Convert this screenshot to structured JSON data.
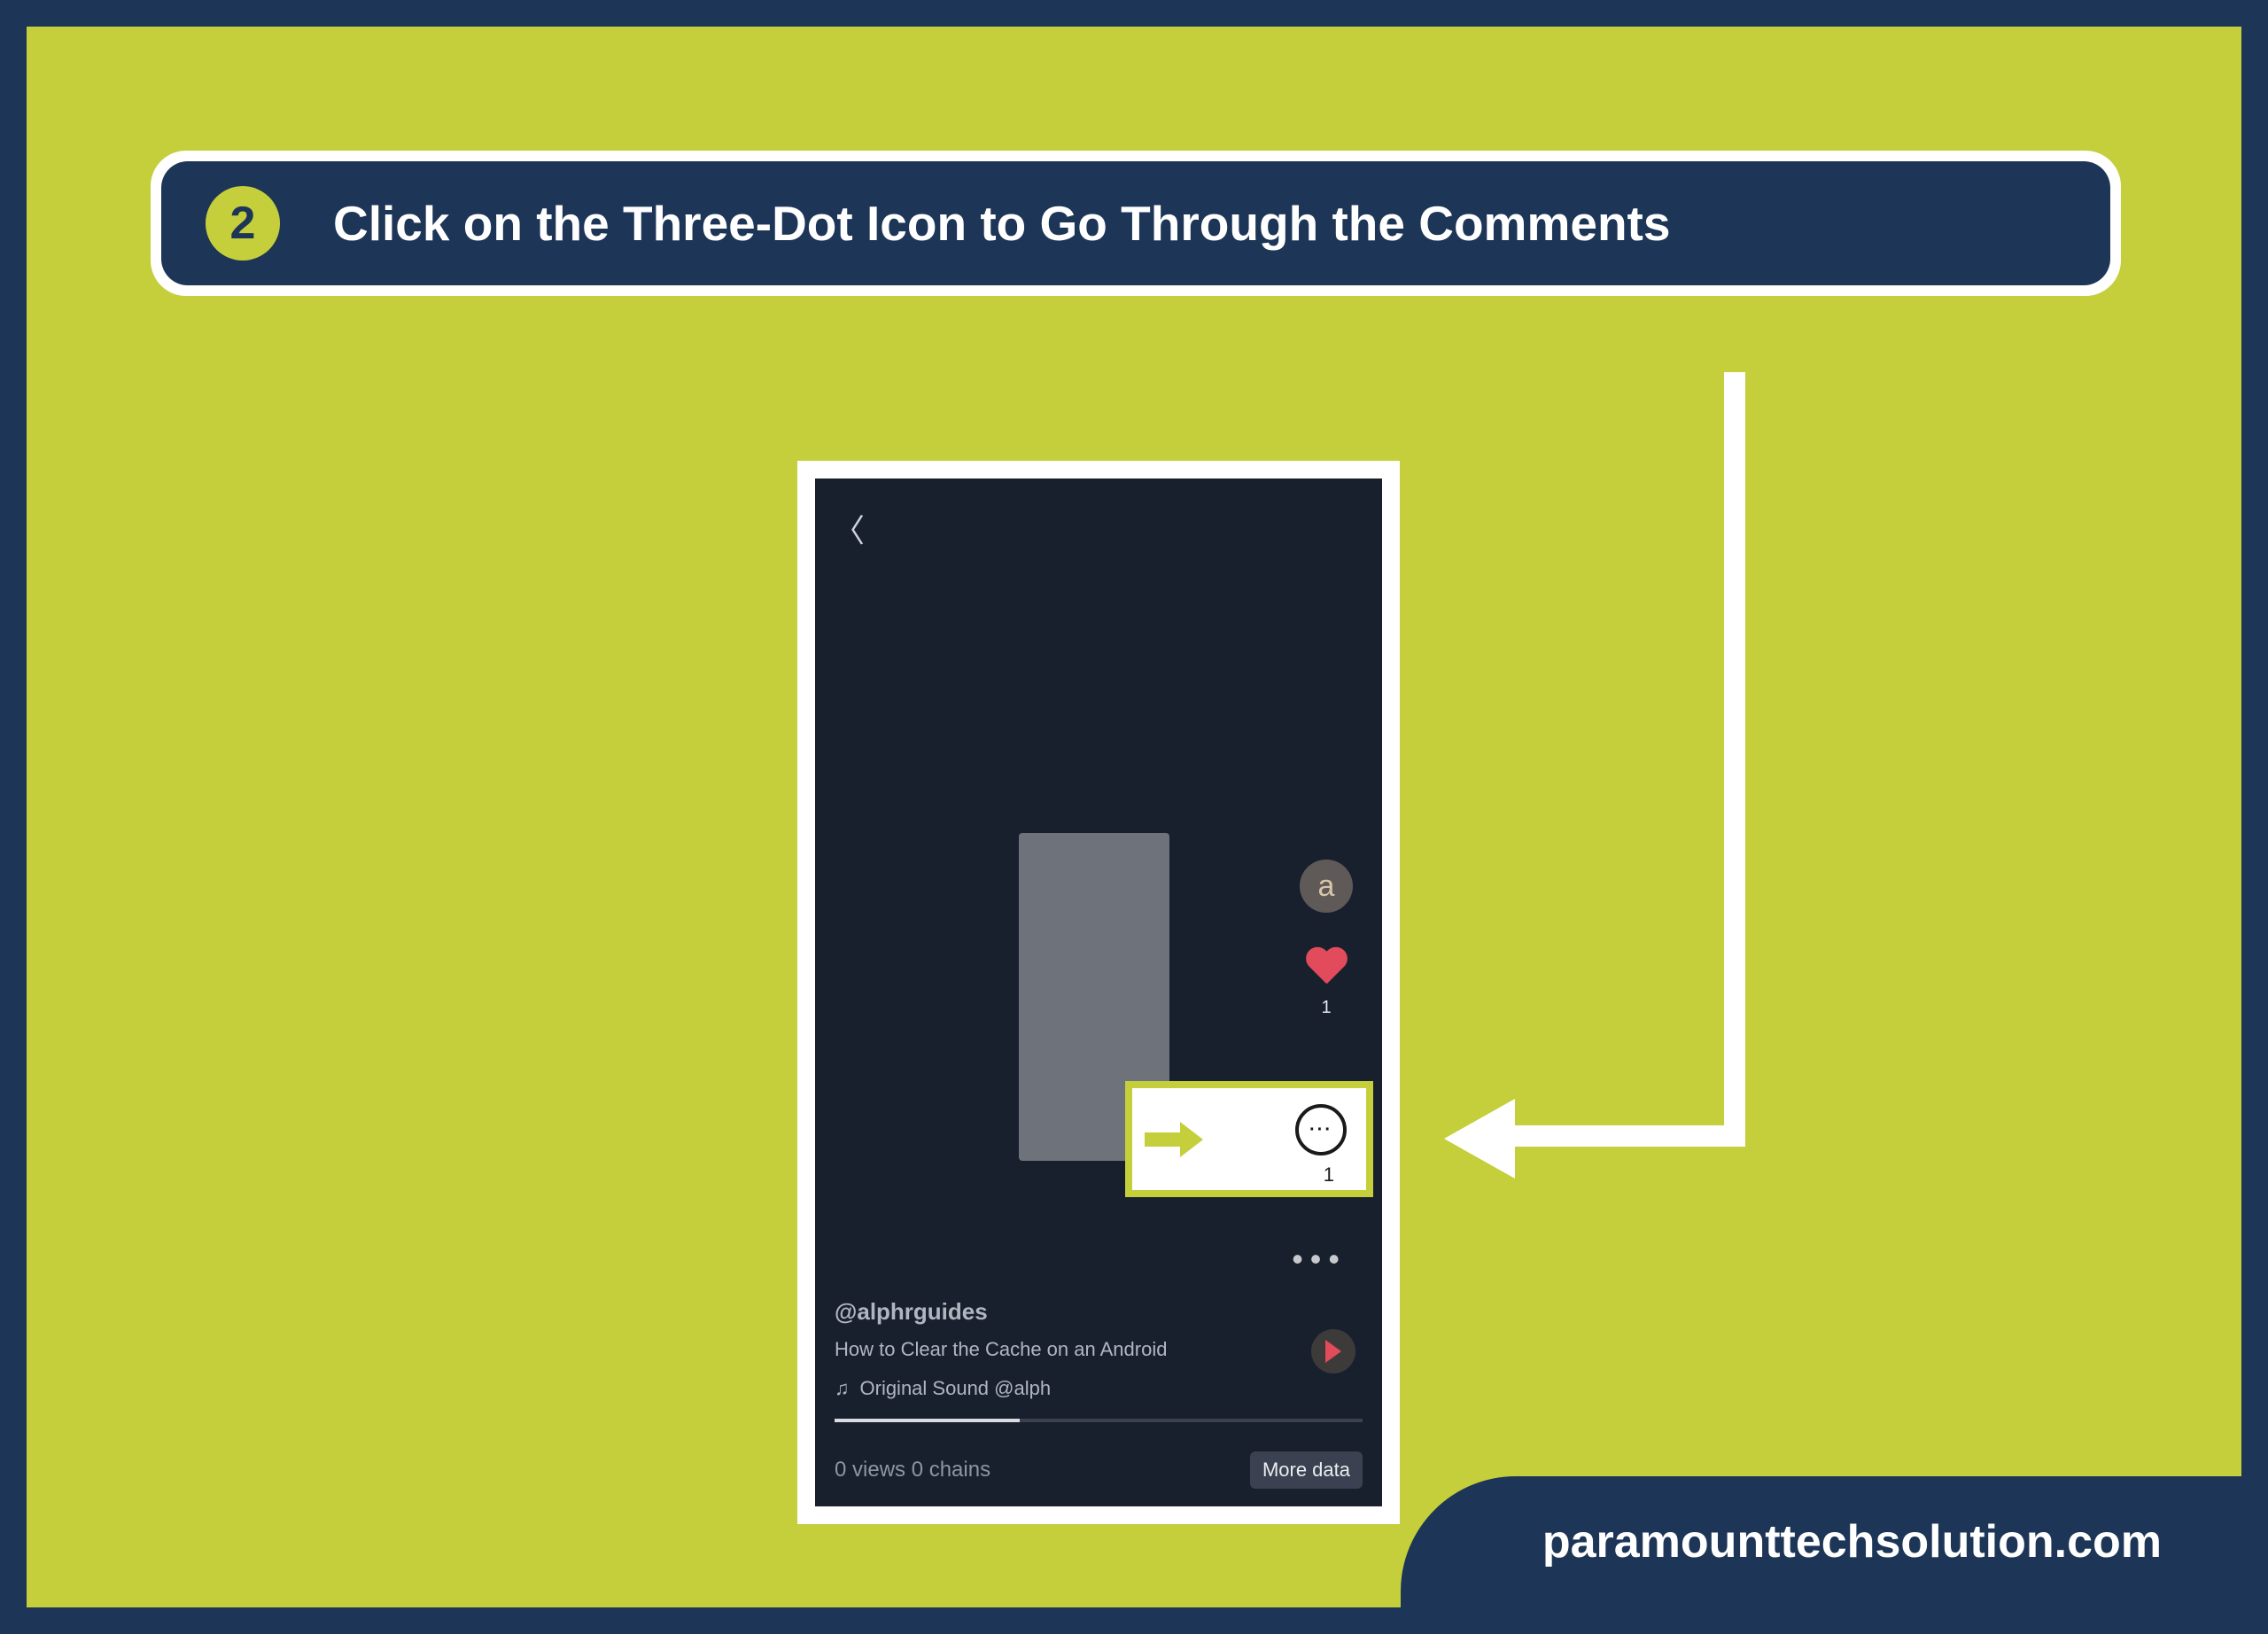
{
  "header": {
    "step_number": "2",
    "title": "Click on the Three-Dot Icon to Go Through the Comments"
  },
  "phone": {
    "avatar_letter": "a",
    "heart_count": "1",
    "comment_count": "1",
    "username": "@alphrguides",
    "video_title": "How to Clear the Cache on an Android",
    "sound_label": "Original Sound   @alph",
    "bottom_stats": "0 views  0 chains",
    "more_label": "More data"
  },
  "watermark": "paramounttechsolution.com"
}
